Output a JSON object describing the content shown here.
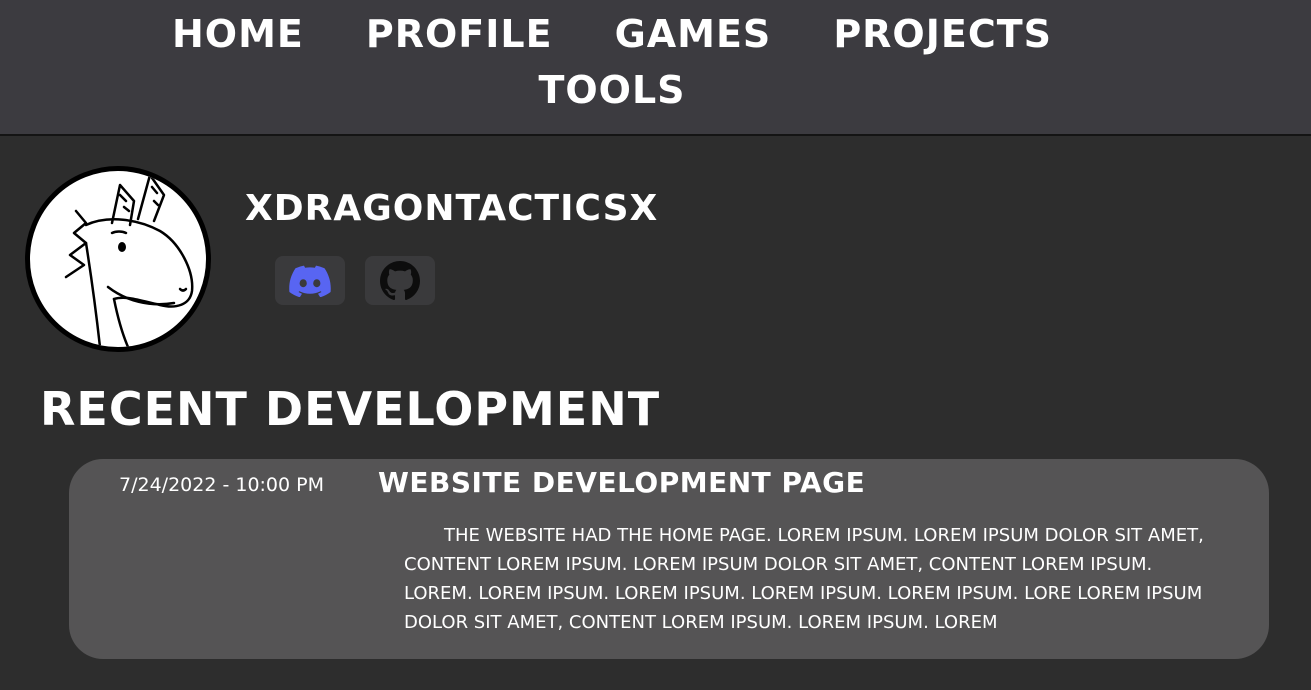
{
  "nav": {
    "items": [
      {
        "label": "HOME"
      },
      {
        "label": "PROFILE"
      },
      {
        "label": "GAMES"
      },
      {
        "label": "PROJECTS"
      },
      {
        "label": "TOOLS"
      }
    ]
  },
  "profile": {
    "username": "XDRAGONTACTICSX",
    "avatar_icon": "dragon-avatar",
    "links": [
      {
        "name": "discord",
        "icon": "discord-icon",
        "color": "#5865f2"
      },
      {
        "name": "github",
        "icon": "github-icon",
        "color": "#0d0d0d"
      }
    ]
  },
  "recent": {
    "heading": "RECENT DEVELOPMENT",
    "entries": [
      {
        "date": "7/24/2022 - 10:00 PM",
        "title": "WEBSITE DEVELOPMENT PAGE",
        "body": "The website had the home page. Lorem ipsum. Lorem ipsum dolor sit amet, content lorem ipsum. Lorem ipsum dolor sit amet, content lorem ipsum. Lorem. Lorem ipsum. Lorem ipsum. Lorem ipsum. Lorem ipsum. Lore lorem ipsum dolor sit amet, content lorem ipsum. Lorem ipsum. Lorem"
      }
    ]
  },
  "colors": {
    "background": "#2d2d2d",
    "nav_background": "#3c3b40",
    "card_background": "#555455",
    "discord_brand": "#5865f2"
  }
}
